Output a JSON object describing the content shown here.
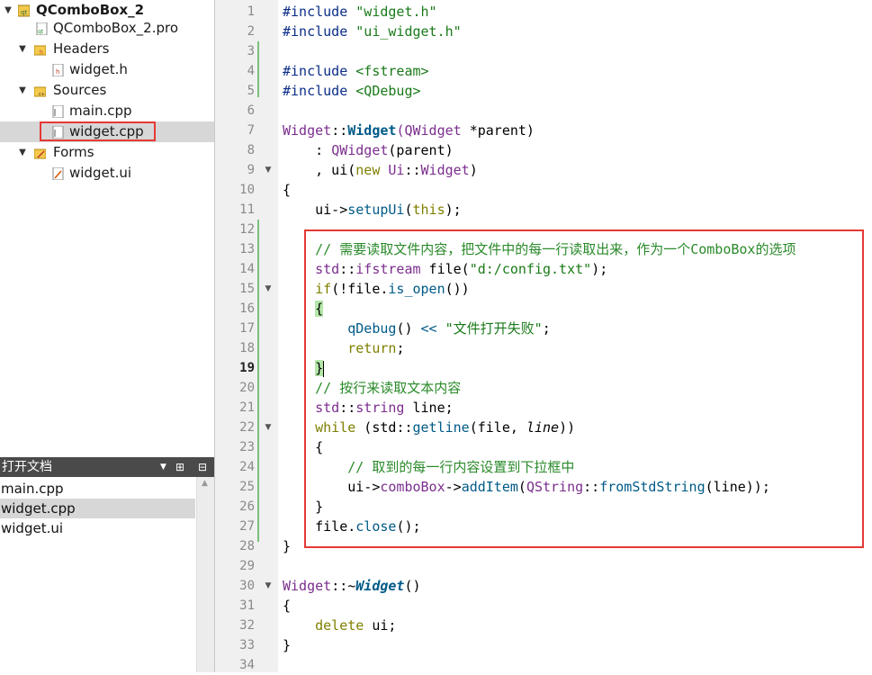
{
  "project_tree": {
    "project_name": "QComboBox_2",
    "pro_file": "QComboBox_2.pro",
    "headers_label": "Headers",
    "header_files": [
      "widget.h"
    ],
    "sources_label": "Sources",
    "source_files": [
      "main.cpp",
      "widget.cpp"
    ],
    "forms_label": "Forms",
    "form_files": [
      "widget.ui"
    ]
  },
  "open_documents": {
    "title": "打开文档",
    "items": [
      "main.cpp",
      "widget.cpp",
      "widget.ui"
    ],
    "selected": "widget.cpp"
  },
  "editor": {
    "current_line": 19,
    "line_numbers": [
      1,
      2,
      3,
      4,
      5,
      6,
      7,
      8,
      9,
      10,
      11,
      12,
      13,
      14,
      15,
      16,
      17,
      18,
      19,
      20,
      21,
      22,
      23,
      24,
      25,
      26,
      27,
      28,
      29,
      30,
      31,
      32,
      33,
      34
    ],
    "code": {
      "l1a": "#include ",
      "l1b": "\"widget.h\"",
      "l2a": "#include ",
      "l2b": "\"ui_widget.h\"",
      "l4a": "#include ",
      "l4b": "<fstream>",
      "l5a": "#include ",
      "l5b": "<QDebug>",
      "l7a": "Widget",
      "l7b": "::",
      "l7c": "Widget",
      "l7d": "(",
      "l7e": "QWidget",
      "l7f": " *parent)",
      "l8a": "    : ",
      "l8b": "QWidget",
      "l8c": "(parent)",
      "l9a": "    , ui(",
      "l9b": "new",
      "l9c": " ",
      "l9d": "Ui",
      "l9e": "::",
      "l9f": "Widget",
      "l9g": ")",
      "l10": "{",
      "l11a": "    ui->",
      "l11b": "setupUi",
      "l11c": "(",
      "l11d": "this",
      "l11e": ");",
      "l13": "    // 需要读取文件内容，把文件中的每一行读取出来，作为一个ComboBox的选项",
      "l14a": "    std",
      "l14b": "::",
      "l14c": "ifstream",
      "l14d": " file(",
      "l14e": "\"d:/config.txt\"",
      "l14f": ");",
      "l15a": "    ",
      "l15b": "if",
      "l15c": "(!file.",
      "l15d": "is_open",
      "l15e": "())",
      "l16a": "    ",
      "l16b": "{",
      "l17a": "        ",
      "l17b": "qDebug",
      "l17c": "() ",
      "l17d": "<<",
      "l17e": " ",
      "l17f": "\"文件打开失败\"",
      "l17g": ";",
      "l18a": "        ",
      "l18b": "return",
      "l18c": ";",
      "l19a": "    ",
      "l19b": "}",
      "l20": "    // 按行来读取文本内容",
      "l21a": "    std",
      "l21b": "::",
      "l21c": "string",
      "l21d": " line;",
      "l22a": "    ",
      "l22b": "while",
      "l22c": " (std",
      "l22d": "::",
      "l22e": "getline",
      "l22f": "(file, ",
      "l22g": "line",
      "l22h": "))",
      "l23": "    {",
      "l24": "        // 取到的每一行内容设置到下拉框中",
      "l25a": "        ui->",
      "l25b": "comboBox",
      "l25c": "->",
      "l25d": "addItem",
      "l25e": "(",
      "l25f": "QString",
      "l25g": "::",
      "l25h": "fromStdString",
      "l25i": "(line));",
      "l26": "    }",
      "l27a": "    file.",
      "l27b": "close",
      "l27c": "();",
      "l28": "}",
      "l30a": "Widget",
      "l30b": "::~",
      "l30c": "Widget",
      "l30d": "()",
      "l31": "{",
      "l32a": "    ",
      "l32b": "delete",
      "l32c": " ui;",
      "l33": "}"
    }
  },
  "colors": {
    "highlight_box": "#e53935",
    "panel_header": "#4a4a4a",
    "gutter": "#f0f0f0"
  }
}
